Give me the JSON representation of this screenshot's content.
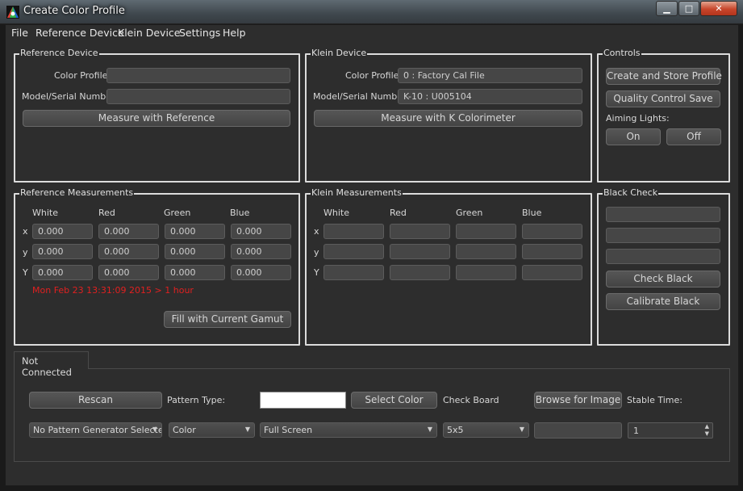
{
  "window": {
    "title": "Create Color Profile"
  },
  "menu": [
    "File",
    "Reference Device",
    "Klein Device",
    "Settings",
    "Help"
  ],
  "reference_device": {
    "title": "Reference Device",
    "color_profile_label": "Color Profile",
    "color_profile_value": "",
    "model_label": "Model/Serial Number",
    "model_value": "",
    "measure_button": "Measure with Reference"
  },
  "klein_device": {
    "title": "Klein Device",
    "color_profile_label": "Color Profile",
    "color_profile_value": "0 : Factory Cal File",
    "model_label": "Model/Serial Number",
    "model_value": "K-10 : U005104",
    "measure_button": "Measure with K Colorimeter"
  },
  "controls": {
    "title": "Controls",
    "create_button": "Create and Store Profile",
    "qc_button": "Quality Control Save",
    "aiming_label": "Aiming Lights:",
    "on_button": "On",
    "off_button": "Off"
  },
  "reference_measurements": {
    "title": "Reference Measurements",
    "columns": [
      "White",
      "Red",
      "Green",
      "Blue"
    ],
    "rows": [
      {
        "label": "x",
        "values": [
          "0.000",
          "0.000",
          "0.000",
          "0.000"
        ]
      },
      {
        "label": "y",
        "values": [
          "0.000",
          "0.000",
          "0.000",
          "0.000"
        ]
      },
      {
        "label": "Y",
        "values": [
          "0.000",
          "0.000",
          "0.000",
          "0.000"
        ]
      }
    ],
    "timestamp": "Mon Feb 23 13:31:09 2015 > 1 hour",
    "fill_button": "Fill with Current Gamut"
  },
  "klein_measurements": {
    "title": "Klein Measurements",
    "columns": [
      "White",
      "Red",
      "Green",
      "Blue"
    ],
    "rows": [
      {
        "label": "x",
        "values": [
          "",
          "",
          "",
          ""
        ]
      },
      {
        "label": "y",
        "values": [
          "",
          "",
          "",
          ""
        ]
      },
      {
        "label": "Y",
        "values": [
          "",
          "",
          "",
          ""
        ]
      }
    ]
  },
  "black_check": {
    "title": "Black Check",
    "fields": [
      "",
      "",
      ""
    ],
    "check_button": "Check Black",
    "calibrate_button": "Calibrate Black"
  },
  "pattern": {
    "tab_label": "Not Connected",
    "rescan_button": "Rescan",
    "pattern_type_label": "Pattern Type:",
    "swatch_color": "#ffffff",
    "select_color_button": "Select Color",
    "checkboard_label": "Check Board",
    "browse_button": "Browse for Image",
    "stable_time_label": "Stable Time:",
    "generator_value": "No Pattern Generator Selecte",
    "type_value": "Color",
    "area_value": "Full Screen",
    "grid_value": "5x5",
    "image_value": "",
    "stable_time_value": "1"
  },
  "colors": {
    "accent_red": "#e02020",
    "background": "#2d2d2d",
    "group_border": "#dcdcdc"
  }
}
